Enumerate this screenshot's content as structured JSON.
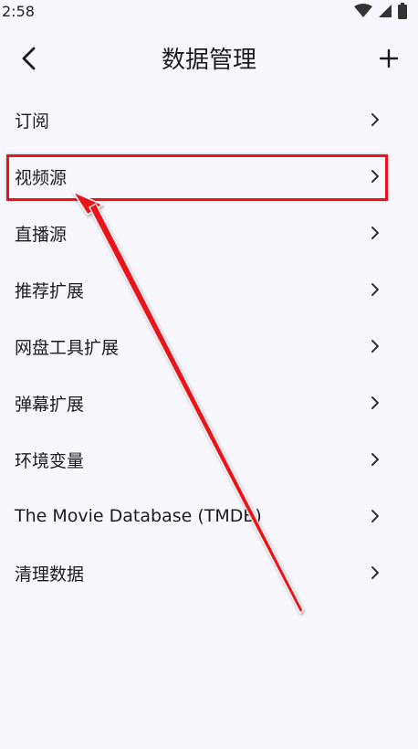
{
  "status_bar": {
    "time": "2:58"
  },
  "app_bar": {
    "title": "数据管理",
    "back_icon": "chevron-left-icon",
    "add_icon": "plus-icon"
  },
  "menu": {
    "items": [
      {
        "label": "订阅"
      },
      {
        "label": "视频源"
      },
      {
        "label": "直播源"
      },
      {
        "label": "推荐扩展"
      },
      {
        "label": "网盘工具扩展"
      },
      {
        "label": "弹幕扩展"
      },
      {
        "label": "环境变量"
      },
      {
        "label": "The Movie Database (TMDB)"
      },
      {
        "label": "清理数据"
      }
    ]
  },
  "annotation": {
    "color": "#e8141c"
  }
}
